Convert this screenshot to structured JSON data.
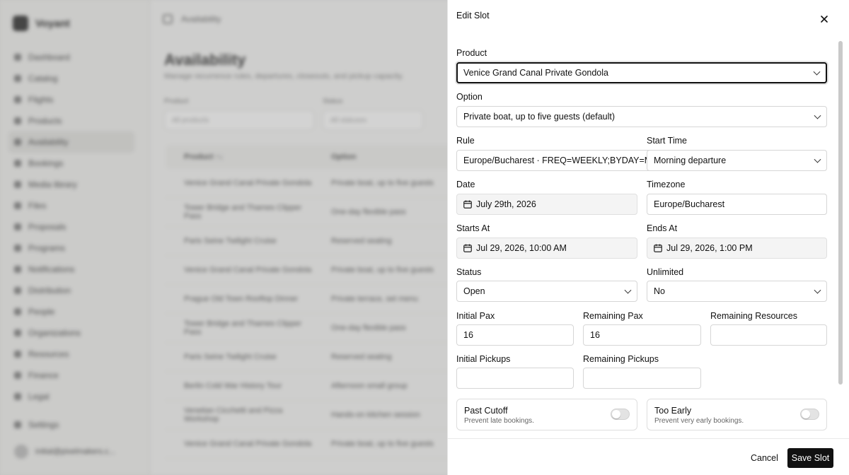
{
  "background": {
    "brand": "Voyant",
    "nav": [
      "Dashboard",
      "Catalog",
      "Flights",
      "Products",
      "Availability",
      "Bookings",
      "Media library",
      "Files",
      "Proposals",
      "Programs",
      "Notifications",
      "Distribution",
      "People",
      "Organizations",
      "Resources",
      "Finance",
      "Legal"
    ],
    "nav_active": "Availability",
    "nav_settings": "Settings",
    "user_email": "initial@pixelmakers.c...",
    "topbar_title": "Availability",
    "page_title": "Availability",
    "page_subtitle": "Manage recurrence rules, departures, closeouts, and pickup capacity.",
    "filters": [
      {
        "label": "Product",
        "value": "All products"
      },
      {
        "label": "Status",
        "value": "All statuses"
      }
    ],
    "table_headers": [
      "Product ↑↓",
      "Option"
    ],
    "table_rows": [
      [
        "Venice Grand Canal Private Gondola",
        "Private boat, up to five guests"
      ],
      [
        "Tower Bridge and Thames Clipper Pass",
        "One-day flexible pass"
      ],
      [
        "Paris Seine Twilight Cruise",
        "Reserved seating"
      ],
      [
        "Venice Grand Canal Private Gondola",
        "Private boat, up to five guests"
      ],
      [
        "Prague Old Town Rooftop Dinner",
        "Private terrace, set menu"
      ],
      [
        "Tower Bridge and Thames Clipper Pass",
        "One-day flexible pass"
      ],
      [
        "Paris Seine Twilight Cruise",
        "Reserved seating"
      ],
      [
        "Berlin Cold War History Tour",
        "Afternoon small group"
      ],
      [
        "Venetian Cicchetti and Pizza Workshop",
        "Hands-on kitchen session"
      ],
      [
        "Venice Grand Canal Private Gondola",
        "Private boat, up to five guests"
      ]
    ]
  },
  "panel": {
    "title": "Edit Slot",
    "product": {
      "label": "Product",
      "value": "Venice Grand Canal Private Gondola"
    },
    "option": {
      "label": "Option",
      "value": "Private boat, up to five guests (default)"
    },
    "rule": {
      "label": "Rule",
      "value": "Europe/Bucharest · FREQ=WEEKLY;BYDAY=MO,WE,FR"
    },
    "start_time": {
      "label": "Start Time",
      "value": "Morning departure"
    },
    "date": {
      "label": "Date",
      "value": "July 29th, 2026"
    },
    "timezone": {
      "label": "Timezone",
      "value": "Europe/Bucharest"
    },
    "starts_at": {
      "label": "Starts At",
      "value": "Jul 29, 2026, 10:00 AM"
    },
    "ends_at": {
      "label": "Ends At",
      "value": "Jul 29, 2026, 1:00 PM"
    },
    "status": {
      "label": "Status",
      "value": "Open"
    },
    "unlimited": {
      "label": "Unlimited",
      "value": "No"
    },
    "initial_pax": {
      "label": "Initial Pax",
      "value": "16"
    },
    "remaining_pax": {
      "label": "Remaining Pax",
      "value": "16"
    },
    "remaining_resources": {
      "label": "Remaining Resources",
      "value": ""
    },
    "initial_pickups": {
      "label": "Initial Pickups",
      "value": ""
    },
    "remaining_pickups": {
      "label": "Remaining Pickups",
      "value": ""
    },
    "past_cutoff": {
      "title": "Past Cutoff",
      "description": "Prevent late bookings.",
      "enabled": false
    },
    "too_early": {
      "title": "Too Early",
      "description": "Prevent very early bookings.",
      "enabled": false
    },
    "cancel_label": "Cancel",
    "save_label": "Save Slot"
  }
}
